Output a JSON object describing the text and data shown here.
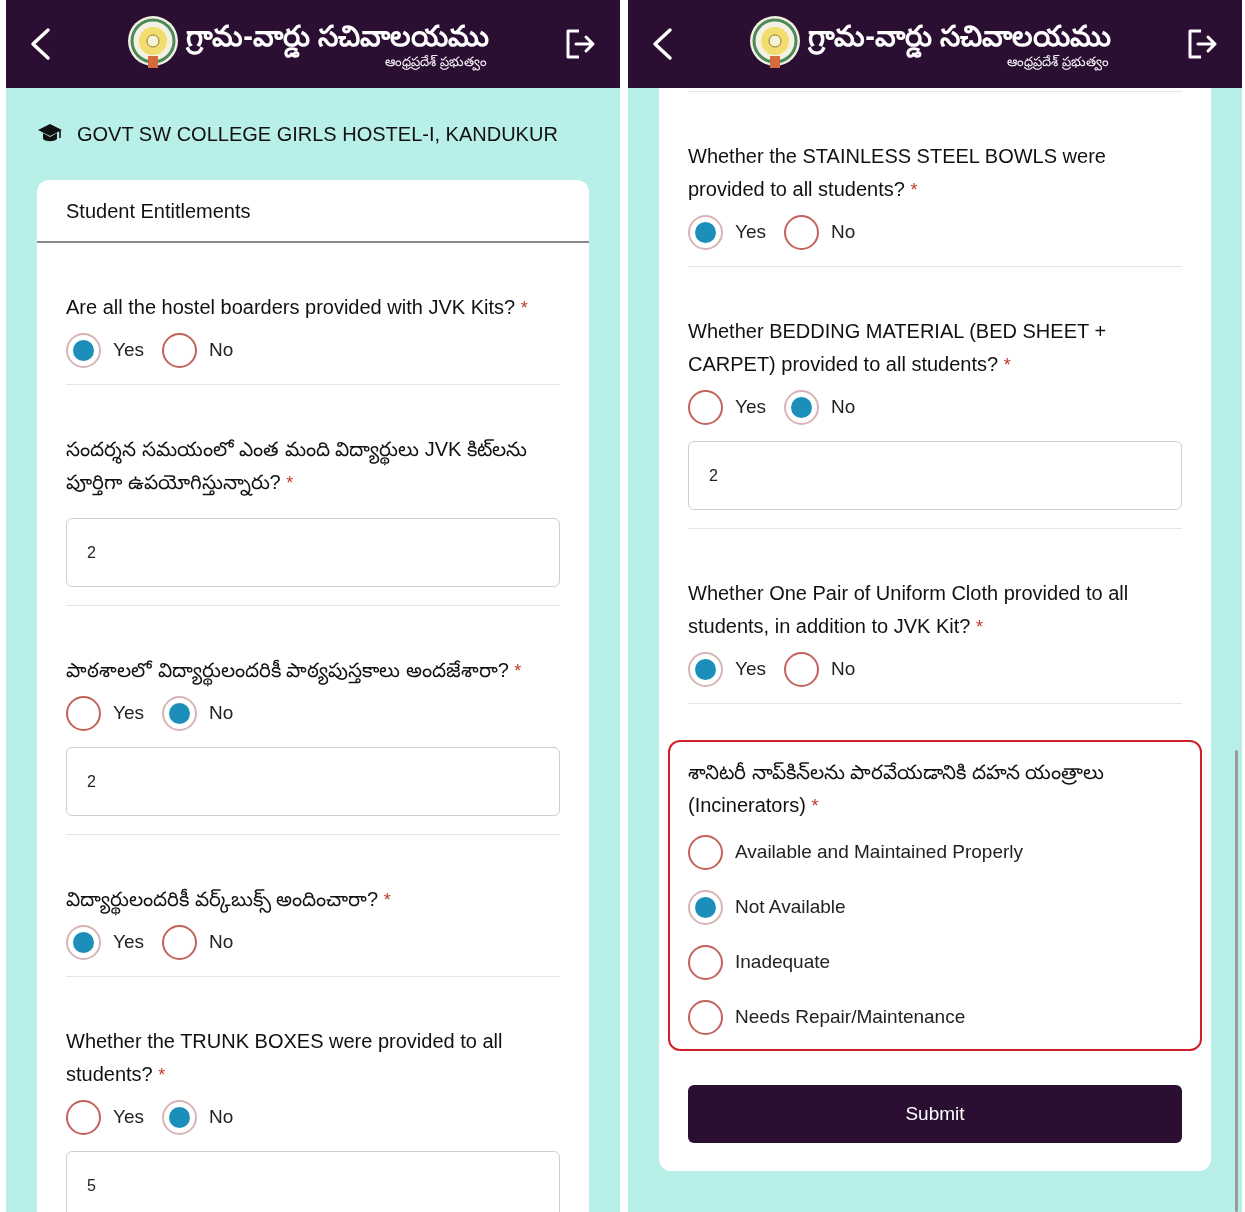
{
  "screens": [
    {
      "header": {
        "title": "గ్రామ-వార్డు సచివాలయము",
        "subtitle": "ఆంధ్రప్రదేశ్ ప్రభుత్వం"
      },
      "hostel_name": "GOVT SW COLLEGE GIRLS HOSTEL-I, KANDUKUR",
      "card_title": "Student Entitlements",
      "questions": [
        {
          "kind": "inline",
          "label": "Are all the hostel boarders provided with JVK Kits?",
          "required_mark": "*",
          "highlighted": false,
          "options": [
            {
              "label": "Yes",
              "selected": true
            },
            {
              "label": "No",
              "selected": false
            }
          ]
        },
        {
          "kind": "text",
          "label": "సందర్శన సమయంలో ఎంత మంది విద్యార్థులు JVK కిట్‌లను పూర్తిగా ఉపయోగిస్తున్నారు?",
          "required_mark": "*",
          "highlighted": false,
          "answer": "2"
        },
        {
          "kind": "inline",
          "label": "పాఠశాలలో విద్యార్థులందరికీ పాఠ్యపుస్తకాలు అందజేశారా?",
          "required_mark": "*",
          "highlighted": false,
          "options": [
            {
              "label": "Yes",
              "selected": false
            },
            {
              "label": "No",
              "selected": true
            }
          ],
          "answer": "2"
        },
        {
          "kind": "inline",
          "label": "విద్యార్థులందరికీ వర్క్‌బుక్స్ అందించారా?",
          "required_mark": "*",
          "highlighted": false,
          "options": [
            {
              "label": "Yes",
              "selected": true
            },
            {
              "label": "No",
              "selected": false
            }
          ]
        },
        {
          "kind": "inline",
          "label": "Whether the TRUNK BOXES were provided to all students?",
          "required_mark": "*",
          "highlighted": false,
          "options": [
            {
              "label": "Yes",
              "selected": false
            },
            {
              "label": "No",
              "selected": true
            }
          ],
          "answer": "5"
        }
      ]
    },
    {
      "header": {
        "title": "గ్రామ-వార్డు సచివాలయము",
        "subtitle": "ఆంధ్రప్రదేశ్ ప్రభుత్వం"
      },
      "submit": "Submit",
      "questions": [
        {
          "kind": "inline",
          "label": "Whether the STAINLESS STEEL BOWLS were provided to all students?",
          "required_mark": "*",
          "highlighted": false,
          "options": [
            {
              "label": "Yes",
              "selected": true
            },
            {
              "label": "No",
              "selected": false
            }
          ]
        },
        {
          "kind": "inline",
          "label": "Whether BEDDING MATERIAL (BED SHEET + CARPET) provided to all students?",
          "required_mark": "*",
          "highlighted": false,
          "options": [
            {
              "label": "Yes",
              "selected": false
            },
            {
              "label": "No",
              "selected": true
            }
          ],
          "answer": "2"
        },
        {
          "kind": "inline",
          "label": "Whether One Pair of Uniform Cloth provided to all students, in addition to JVK Kit?",
          "required_mark": "*",
          "highlighted": false,
          "options": [
            {
              "label": "Yes",
              "selected": true
            },
            {
              "label": "No",
              "selected": false
            }
          ]
        },
        {
          "kind": "stacked",
          "label": "శానిటరీ నాప్‌కిన్‌లను పారవేయడానికి దహన యంత్రాలు\n(Incinerators)",
          "required_mark": "*",
          "highlighted": true,
          "options": [
            {
              "label": "Available and Maintained Properly",
              "selected": false
            },
            {
              "label": "Not Available",
              "selected": true
            },
            {
              "label": "Inadequate",
              "selected": false
            },
            {
              "label": "Needs Repair/Maintenance",
              "selected": false
            }
          ]
        }
      ]
    }
  ]
}
